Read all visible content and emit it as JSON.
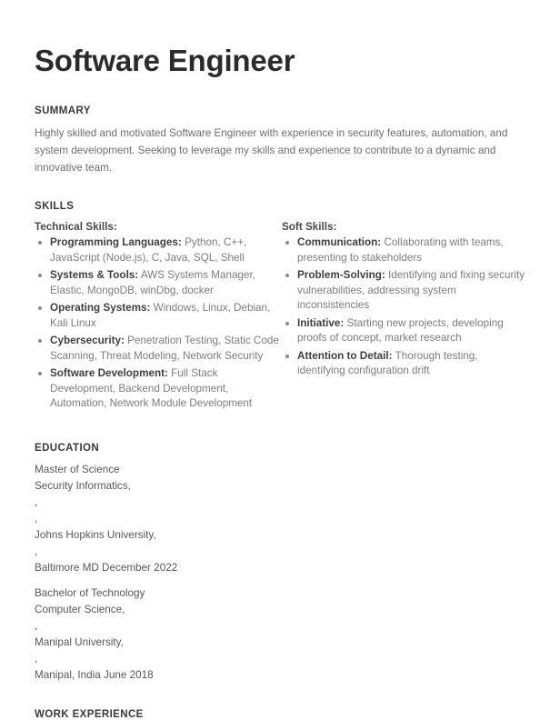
{
  "document": {
    "title": "Software Engineer"
  },
  "summary": {
    "heading": "SUMMARY",
    "text": "Highly skilled and motivated Software Engineer with experience in security features, automation, and system development. Seeking to leverage my skills and experience to contribute to a dynamic and innovative team."
  },
  "skills": {
    "heading": "SKILLS",
    "technical": {
      "heading": "Technical Skills:",
      "items": [
        {
          "label": "Programming Languages:",
          "value": "Python, C++, JavaScript (Node.js), C, Java, SQL, Shell"
        },
        {
          "label": "Systems & Tools:",
          "value": "AWS Systems Manager, Elastic, MongoDB, winDbg, docker"
        },
        {
          "label": "Operating Systems:",
          "value": "Windows, Linux, Debian, Kali Linux"
        },
        {
          "label": "Cybersecurity:",
          "value": "Penetration Testing, Static Code Scanning, Threat Modeling, Network Security"
        },
        {
          "label": "Software Development:",
          "value": "Full Stack Development, Backend Development, Automation, Network Module Development"
        }
      ]
    },
    "soft": {
      "heading": "Soft Skills:",
      "items": [
        {
          "label": "Communication:",
          "value": "Collaborating with teams, presenting to stakeholders"
        },
        {
          "label": "Problem-Solving:",
          "value": "Identifying and fixing security vulnerabilities, addressing system inconsistencies"
        },
        {
          "label": "Initiative:",
          "value": "Starting new projects, developing proofs of concept, market research"
        },
        {
          "label": "Attention to Detail:",
          "value": "Thorough testing, identifying configuration drift"
        }
      ]
    }
  },
  "education": {
    "heading": "EDUCATION",
    "entries": [
      {
        "lines": [
          "Master of Science",
          "Security Informatics,",
          ",",
          ",",
          "Johns Hopkins University,",
          ",",
          "Baltimore MD December 2022"
        ]
      },
      {
        "lines": [
          "Bachelor of Technology",
          "Computer Science,",
          ",",
          "Manipal University,",
          ",",
          "Manipal, India June 2018"
        ]
      }
    ]
  },
  "work_experience": {
    "heading": "WORK EXPERIENCE"
  }
}
